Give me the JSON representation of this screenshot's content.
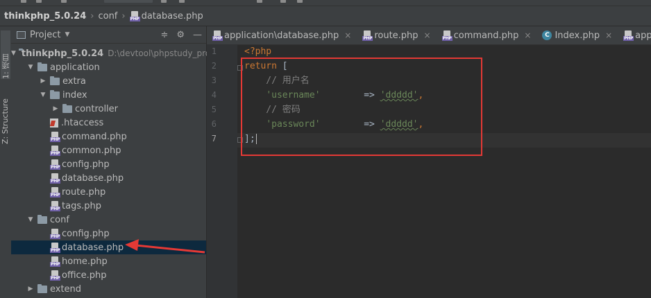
{
  "breadcrumb": {
    "project": "thinkphp_5.0.24",
    "folder": "conf",
    "file": "database.php"
  },
  "left_toolbar": {
    "project_tab": "1: 项目",
    "structure_tab": "Z: Structure"
  },
  "project_panel": {
    "title": "Project",
    "tools": [
      "≑",
      "⚙",
      "—"
    ]
  },
  "tree": [
    {
      "label": "thinkphp_5.0.24",
      "path": "D:\\devtool\\phpstudy_pro",
      "type": "folder",
      "expanded": true,
      "depth": 0
    },
    {
      "label": "application",
      "type": "folder",
      "expanded": true,
      "depth": 1
    },
    {
      "label": "extra",
      "type": "folder",
      "expanded": false,
      "depth": 2
    },
    {
      "label": "index",
      "type": "folder",
      "expanded": true,
      "depth": 2
    },
    {
      "label": "controller",
      "type": "folder",
      "expanded": false,
      "depth": 3
    },
    {
      "label": ".htaccess",
      "type": "htaccess",
      "depth": 2
    },
    {
      "label": "command.php",
      "type": "php",
      "depth": 2
    },
    {
      "label": "common.php",
      "type": "php",
      "depth": 2
    },
    {
      "label": "config.php",
      "type": "php",
      "depth": 2
    },
    {
      "label": "database.php",
      "type": "php",
      "depth": 2
    },
    {
      "label": "route.php",
      "type": "php",
      "depth": 2
    },
    {
      "label": "tags.php",
      "type": "php",
      "depth": 2
    },
    {
      "label": "conf",
      "type": "folder",
      "expanded": true,
      "depth": 1
    },
    {
      "label": "config.php",
      "type": "php",
      "depth": 2
    },
    {
      "label": "database.php",
      "type": "php",
      "depth": 2,
      "selected": true
    },
    {
      "label": "home.php",
      "type": "php",
      "depth": 2
    },
    {
      "label": "office.php",
      "type": "php",
      "depth": 2
    },
    {
      "label": "extend",
      "type": "folder",
      "expanded": false,
      "depth": 1
    }
  ],
  "tabs": [
    {
      "label": "application\\database.php",
      "icon": "php"
    },
    {
      "label": "route.php",
      "icon": "php"
    },
    {
      "label": "command.php",
      "icon": "php"
    },
    {
      "label": "Index.php",
      "icon": "class"
    },
    {
      "label": "application",
      "icon": "php"
    }
  ],
  "editor": {
    "line_numbers": [
      "1",
      "2",
      "3",
      "4",
      "5",
      "6",
      "7"
    ],
    "current_line": 7,
    "lines": {
      "l1": "<?php",
      "l2_kw": "return",
      "l2_rest": " [",
      "l3": "    // 用户名",
      "l4_key": "'username'",
      "l4_arrow": "        => ",
      "l4_val": "'ddddd'",
      "l4_end": ",",
      "l5": "    // 密码",
      "l6_key": "'password'",
      "l6_arrow": "        => ",
      "l6_val": "'ddddd'",
      "l6_end": ",",
      "l7": "];"
    }
  },
  "colors": {
    "annotation": "#e53935",
    "keyword": "#cc7832",
    "string": "#6a8759",
    "comment": "#808080",
    "selection": "#0d293e"
  }
}
